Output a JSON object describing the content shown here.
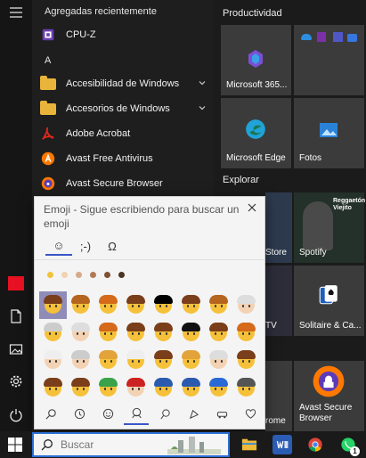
{
  "start_menu": {
    "recent_heading": "Agregadas recientemente",
    "letter_a": "A",
    "apps": [
      {
        "label": "CPU-Z",
        "icon": "cpuz-icon"
      },
      {
        "label": "Accesibilidad de Windows",
        "icon": "folder-icon",
        "expandable": true
      },
      {
        "label": "Accesorios de Windows",
        "icon": "folder-icon",
        "expandable": true
      },
      {
        "label": "Adobe Acrobat",
        "icon": "adobe-acrobat-icon"
      },
      {
        "label": "Avast Free Antivirus",
        "icon": "avast-icon"
      },
      {
        "label": "Avast Secure Browser",
        "icon": "avast-browser-icon"
      }
    ]
  },
  "tiles": {
    "group_productividad": "Productividad",
    "group_explorar": "Explorar",
    "microsoft365": "Microsoft 365...",
    "edge": "Microsoft Edge",
    "fotos": "Fotos",
    "store": "Store",
    "spotify": "Spotify",
    "spotify_art_text": "Reggaetón Viejito",
    "tv": "TV",
    "solitaire": "Solitaire & Ca...",
    "chrome": "rome",
    "avast_tile": "Avast Secure Browser"
  },
  "emoji_panel": {
    "title": "Emoji - Sigue escribiendo para buscar un emoji",
    "tabs": [
      {
        "label": "☺",
        "name": "tab-emoji"
      },
      {
        "label": ";-)",
        "name": "tab-kaomoji"
      },
      {
        "label": "Ω",
        "name": "tab-symbols"
      }
    ],
    "skin_tones": [
      "#f0c33c",
      "#f2d2b0",
      "#d7a98a",
      "#b07a55",
      "#7e5233",
      "#4a3424"
    ],
    "colors": {
      "accent": "#3a56c6",
      "selected_bg": "#8f8db8"
    }
  },
  "taskbar": {
    "search_placeholder": "Buscar",
    "notification_count": "1"
  }
}
